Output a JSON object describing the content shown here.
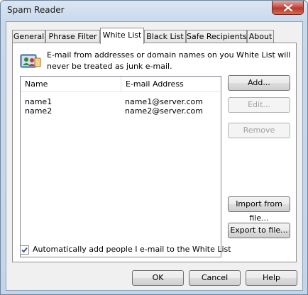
{
  "window": {
    "title": "Spam Reader"
  },
  "tabs": [
    {
      "label": "General"
    },
    {
      "label": "Phrase Filter"
    },
    {
      "label": "White List"
    },
    {
      "label": "Black List"
    },
    {
      "label": "Safe Recipients"
    },
    {
      "label": "About"
    }
  ],
  "active_tab": "White List",
  "panel": {
    "info_text": "E-mail from addresses or domain names on you White List will never be treated as junk e-mail.",
    "columns": [
      "Name",
      "E-mail Address"
    ],
    "rows": [
      {
        "name": "name1",
        "email": "name1@server.com"
      },
      {
        "name": "name2",
        "email": "name2@server.com"
      }
    ],
    "buttons": {
      "add": "Add...",
      "edit": "Edit...",
      "remove": "Remove",
      "import": "Import from file...",
      "export": "Export to file..."
    },
    "auto_add_label": "Automatically add people I e-mail to the White List",
    "auto_add_checked": true
  },
  "dialog_buttons": {
    "ok": "OK",
    "cancel": "Cancel",
    "help": "Help"
  }
}
